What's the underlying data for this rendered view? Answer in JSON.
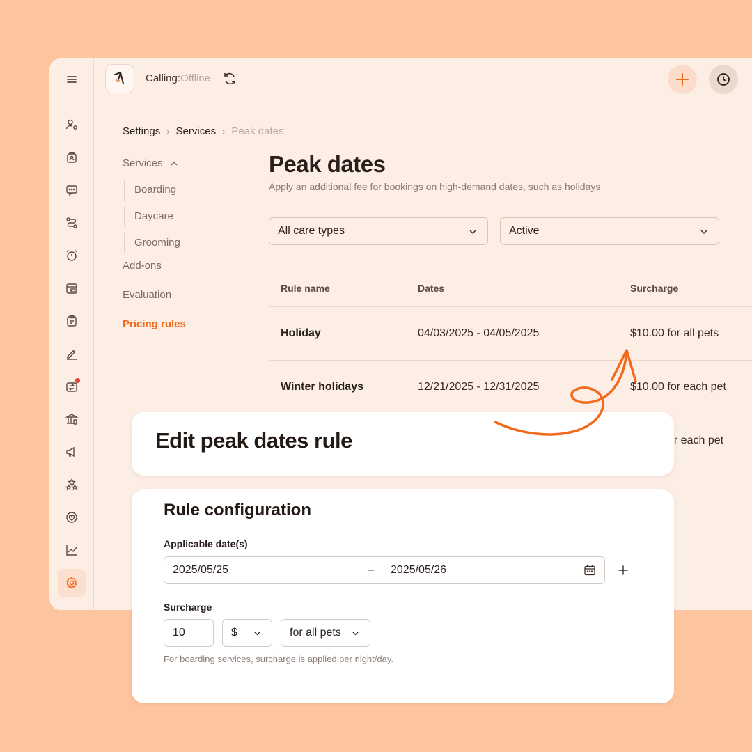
{
  "topbar": {
    "calling_label": "Calling:",
    "calling_status": "Offline"
  },
  "breadcrumb": {
    "items": [
      "Settings",
      "Services",
      "Peak dates"
    ]
  },
  "subnav": {
    "services": "Services",
    "boarding": "Boarding",
    "daycare": "Daycare",
    "grooming": "Grooming",
    "addons": "Add-ons",
    "evaluation": "Evaluation",
    "pricing_rules": "Pricing rules"
  },
  "page": {
    "title": "Peak dates",
    "description": "Apply an additional fee for bookings on high-demand dates, such as holidays"
  },
  "filters": {
    "care_type": "All care types",
    "status": "Active"
  },
  "table": {
    "headers": [
      "Rule name",
      "Dates",
      "Surcharge"
    ],
    "rows": [
      {
        "name": "Holiday",
        "dates": "04/03/2025 - 04/05/2025",
        "surcharge": "$10.00 for all pets"
      },
      {
        "name": "Winter holidays",
        "dates": "12/21/2025 - 12/31/2025",
        "surcharge": "$10.00 for each pet"
      },
      {
        "surcharge_partial": "or each pet"
      }
    ]
  },
  "edit_card": {
    "title": "Edit peak dates rule"
  },
  "config": {
    "title": "Rule configuration",
    "dates_label": "Applicable date(s)",
    "start_date": "2025/05/25",
    "end_date": "2025/05/26",
    "dash": "–",
    "surcharge_label": "Surcharge",
    "amount": "10",
    "currency": "$",
    "applies_to": "for all pets",
    "hint": "For boarding services, surcharge is applied per night/day."
  },
  "colors": {
    "accent": "#f26a1b",
    "background": "#fdc4a0",
    "app_bg": "#fcede5"
  }
}
